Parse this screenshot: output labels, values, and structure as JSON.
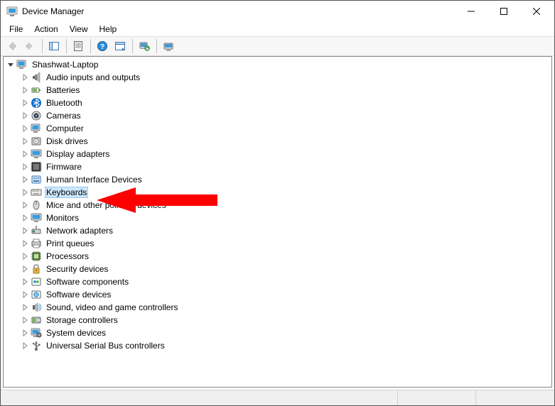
{
  "window": {
    "title": "Device Manager"
  },
  "menu": {
    "file": "File",
    "action": "Action",
    "view": "View",
    "help": "Help"
  },
  "tree": {
    "root": "Shashwat-Laptop",
    "items": [
      {
        "label": "Audio inputs and outputs",
        "icon": "audio"
      },
      {
        "label": "Batteries",
        "icon": "battery"
      },
      {
        "label": "Bluetooth",
        "icon": "bluetooth"
      },
      {
        "label": "Cameras",
        "icon": "camera"
      },
      {
        "label": "Computer",
        "icon": "computer"
      },
      {
        "label": "Disk drives",
        "icon": "disk"
      },
      {
        "label": "Display adapters",
        "icon": "display"
      },
      {
        "label": "Firmware",
        "icon": "firmware"
      },
      {
        "label": "Human Interface Devices",
        "icon": "hid"
      },
      {
        "label": "Keyboards",
        "icon": "keyboard",
        "selected": true
      },
      {
        "label": "Mice and other pointing devices",
        "icon": "mouse"
      },
      {
        "label": "Monitors",
        "icon": "monitor"
      },
      {
        "label": "Network adapters",
        "icon": "network"
      },
      {
        "label": "Print queues",
        "icon": "printer"
      },
      {
        "label": "Processors",
        "icon": "cpu"
      },
      {
        "label": "Security devices",
        "icon": "security"
      },
      {
        "label": "Software components",
        "icon": "swcomp"
      },
      {
        "label": "Software devices",
        "icon": "swdev"
      },
      {
        "label": "Sound, video and game controllers",
        "icon": "sound"
      },
      {
        "label": "Storage controllers",
        "icon": "storage"
      },
      {
        "label": "System devices",
        "icon": "system"
      },
      {
        "label": "Universal Serial Bus controllers",
        "icon": "usb"
      }
    ]
  }
}
